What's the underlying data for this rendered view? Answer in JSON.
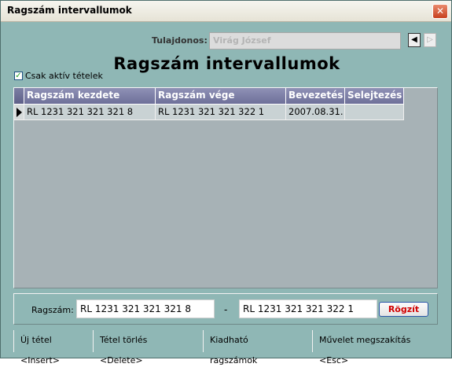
{
  "window": {
    "title": "Ragszám intervallumok",
    "close_symbol": "✕"
  },
  "owner": {
    "label": "Tulajdonos:",
    "value": "Virág József"
  },
  "nav": {
    "back_symbol": "◀",
    "forward_symbol": "▷"
  },
  "filter": {
    "checkbox_label": "Csak aktív tételek",
    "checked": true,
    "check_mark": "✓"
  },
  "heading": "Ragszám intervallumok",
  "grid": {
    "columns": [
      "Ragszám kezdete",
      "Ragszám vége",
      "Bevezetés",
      "Selejtezés"
    ],
    "rows": [
      {
        "start": "RL 1231 321 321 321 8",
        "end": "RL 1231 321 321 322 1",
        "introduced": "2007.08.31.",
        "scrapped": ""
      }
    ]
  },
  "editor": {
    "label": "Ragszám:",
    "start_value": "RL 1231 321 321 321 8",
    "separator": "-",
    "end_value": "RL 1231 321 321 322 1",
    "save_label": "Rögzít"
  },
  "statusbar": {
    "new_item": "Új tétel <Insert>",
    "delete_item": "Tétel törlés <Delete>",
    "issuable": "Kiadható ragszámok",
    "cancel": "Művelet megszakítás <Esc>"
  },
  "colors": {
    "window_bg": "#8fb7b5",
    "header_bg": "#7c7fa6",
    "grid_bg": "#a7b2b6",
    "save_text": "#d10000"
  }
}
